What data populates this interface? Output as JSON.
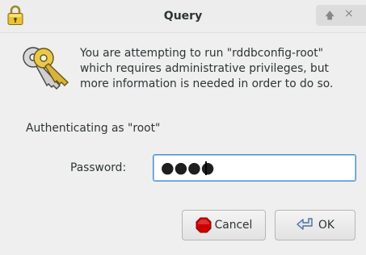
{
  "window": {
    "title": "Query",
    "title_icon": "padlock-icon",
    "controls": {
      "up": "🡅",
      "close": "×"
    }
  },
  "dialog": {
    "icon": "keys-icon",
    "message_lines": [
      "You are attempting to run \"rddbconfig-root\"",
      "which requires administrative privileges, but",
      "more information is needed in order to do so."
    ],
    "authenticating_as": "Authenticating as \"root\"",
    "password_label": "Password:",
    "password_masked": "●●●●"
  },
  "buttons": {
    "cancel": {
      "label": "Cancel",
      "icon": "stop-icon"
    },
    "ok": {
      "label": "OK",
      "icon": "return-arrow-icon"
    }
  },
  "colors": {
    "accent": "#4a90d9",
    "stop_red": "#cc0000"
  }
}
